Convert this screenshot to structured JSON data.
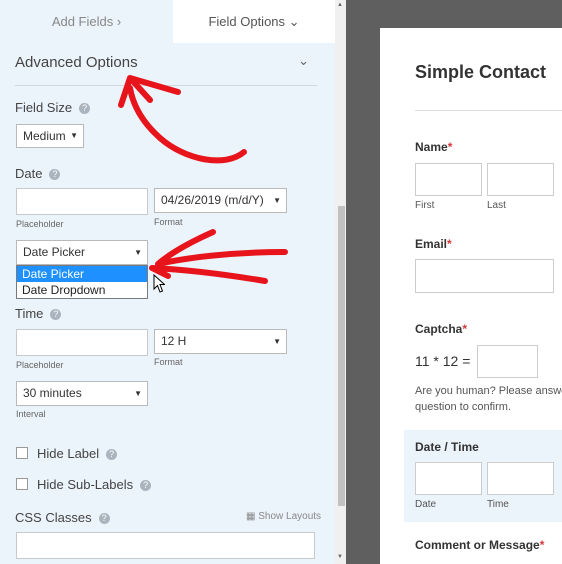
{
  "tabs": {
    "add_fields": "Add Fields ›",
    "field_options": "Field Options ⌄"
  },
  "advanced": {
    "title": "Advanced Options"
  },
  "field_size": {
    "label": "Field Size",
    "value": "Medium"
  },
  "date": {
    "label": "Date",
    "placeholder_label": "Placeholder",
    "format_value": "04/26/2019 (m/d/Y)",
    "format_label": "Format",
    "type_value": "Date Picker",
    "dropdown_options": [
      "Date Picker",
      "Date Dropdown"
    ]
  },
  "time": {
    "label": "Time",
    "placeholder_label": "Placeholder",
    "format_value": "12 H",
    "format_label": "Format",
    "interval_value": "30 minutes",
    "interval_label": "Interval"
  },
  "hide_label": "Hide Label",
  "hide_sublabels": "Hide Sub-Labels",
  "css_classes": {
    "label": "CSS Classes",
    "show_layouts": "Show Layouts"
  },
  "preview": {
    "title": "Simple Contact",
    "name_label": "Name",
    "first": "First",
    "last": "Last",
    "email_label": "Email",
    "captcha_label": "Captcha",
    "captcha_question": "11 * 12 =",
    "captcha_help_line1": "Are you human? Please answer",
    "captcha_help_line2": "question to confirm.",
    "datetime_label": "Date / Time",
    "date_sub": "Date",
    "time_sub": "Time",
    "comment_label": "Comment or Message",
    "required_mark": "*"
  },
  "annotation_color": "#e8141b"
}
